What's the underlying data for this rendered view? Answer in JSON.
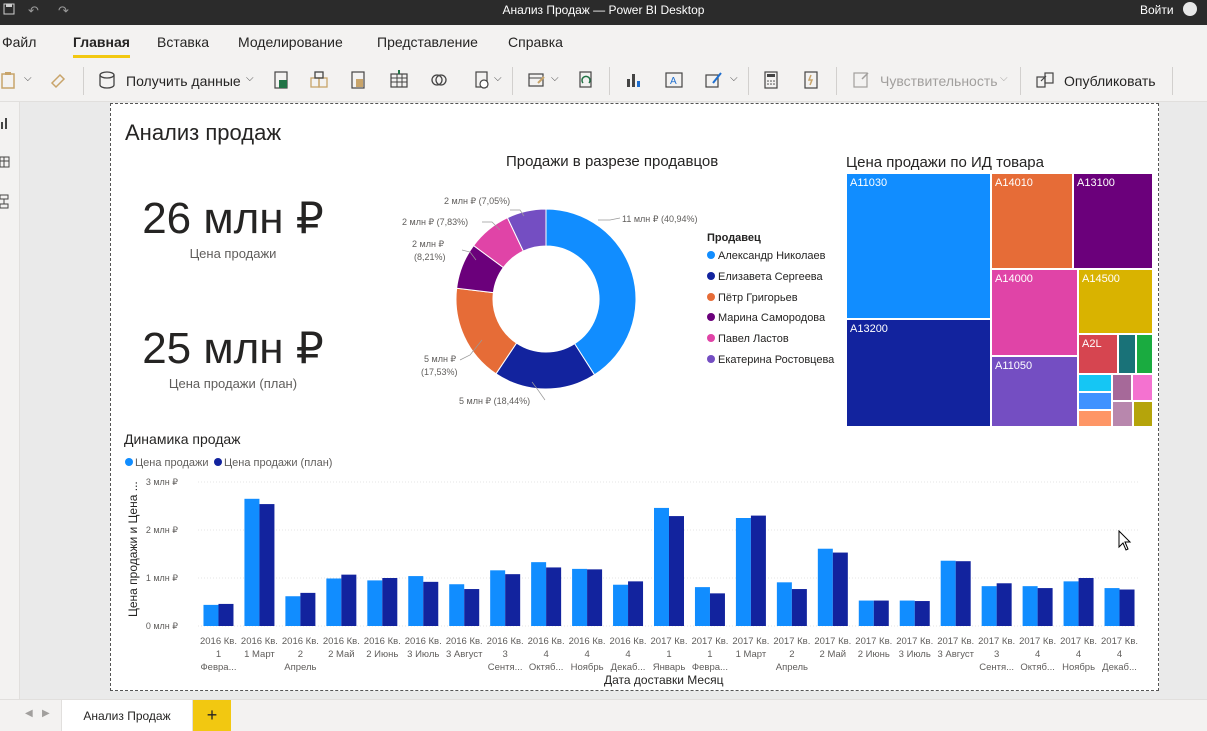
{
  "window": {
    "title": "Анализ Продаж — Power BI Desktop",
    "signin": "Войти"
  },
  "menu": {
    "tabs": [
      "Файл",
      "Главная",
      "Вставка",
      "Моделирование",
      "Представление",
      "Справка"
    ],
    "active": "Главная"
  },
  "ribbon": {
    "get_data": "Получить данные",
    "sensitivity": "Чувствительность",
    "publish": "Опубликовать"
  },
  "report": {
    "title": "Анализ продаж",
    "kpi1": {
      "value": "26 млн ₽",
      "label": "Цена продажи"
    },
    "kpi2": {
      "value": "25 млн ₽",
      "label": "Цена продажи (план)"
    }
  },
  "donut": {
    "title": "Продажи в разрезе продавцов",
    "legend_title": "Продавец",
    "slices": [
      {
        "name": "Александр Николаев",
        "label": "11 млн ₽ (40,94%)",
        "pct": 40.94,
        "color": "#118dff"
      },
      {
        "name": "Елизавета Сергеева",
        "label": "5 млн ₽ (18,44%)",
        "pct": 18.44,
        "color": "#12239e"
      },
      {
        "name": "Пётр Григорьев",
        "label": "5 млн ₽ (17,53%)",
        "pct": 17.53,
        "color": "#e66c37"
      },
      {
        "name": "Марина Самородова",
        "label": "2 млн ₽ (8,21%)",
        "pct": 8.21,
        "color": "#6b007b"
      },
      {
        "name": "Павел Ластов",
        "label": "2 млн ₽ (7,83%)",
        "pct": 7.83,
        "color": "#e044a7"
      },
      {
        "name": "Екатерина Ростовцева",
        "label": "2 млн ₽ (7,05%)",
        "pct": 7.05,
        "color": "#744ec2"
      }
    ],
    "outside_labels": {
      "s0": "11 млн ₽ (40,94%)",
      "s1": "5 млн ₽ (18,44%)",
      "s2a": "5 млн ₽",
      "s2b": "(17,53%)",
      "s3a": "2 млн ₽",
      "s3b": "(8,21%)",
      "s4": "2 млн ₽ (7,83%)",
      "s5": "2 млн ₽ (7,05%)"
    }
  },
  "treemap": {
    "title": "Цена продажи по ИД товара",
    "cells": [
      {
        "id": "A11030",
        "color": "#118dff"
      },
      {
        "id": "A13200",
        "color": "#12239e"
      },
      {
        "id": "A14010",
        "color": "#e66c37"
      },
      {
        "id": "A13100",
        "color": "#6b007b"
      },
      {
        "id": "A14000",
        "color": "#e044a7"
      },
      {
        "id": "A14500",
        "color": "#d9b300"
      },
      {
        "id": "A11050",
        "color": "#744ec2"
      },
      {
        "id": "A2L",
        "color": "#d64550"
      }
    ]
  },
  "columns": {
    "title": "Динамика продаж",
    "legend": [
      "Цена продажи",
      "Цена продажи (план)"
    ],
    "colors": [
      "#118dff",
      "#12239e"
    ],
    "xlabel": "Дата доставки Месяц",
    "ylabel": "Цена продажи и Цена ...",
    "y_ticks": [
      "0 млн ₽",
      "1 млн ₽",
      "2 млн ₽",
      "3 млн ₽"
    ]
  },
  "chart_data": {
    "type": "bar",
    "title": "Динамика продаж",
    "xlabel": "Дата доставки Месяц",
    "ylabel": "Цена продажи и Цена ...",
    "ylim": [
      0,
      3
    ],
    "categories": [
      [
        "2016 Кв.",
        "1",
        "Февра..."
      ],
      [
        "2016 Кв.",
        "1 Март",
        ""
      ],
      [
        "2016 Кв.",
        "2",
        "Апрель"
      ],
      [
        "2016 Кв.",
        "2 Май",
        ""
      ],
      [
        "2016 Кв.",
        "2 Июнь",
        ""
      ],
      [
        "2016 Кв.",
        "3 Июль",
        ""
      ],
      [
        "2016 Кв.",
        "3 Август",
        ""
      ],
      [
        "2016 Кв.",
        "3",
        "Сентя..."
      ],
      [
        "2016 Кв.",
        "4",
        "Октяб..."
      ],
      [
        "2016 Кв.",
        "4",
        "Ноябрь"
      ],
      [
        "2016 Кв.",
        "4",
        "Декаб..."
      ],
      [
        "2017 Кв.",
        "1",
        "Январь"
      ],
      [
        "2017 Кв.",
        "1",
        "Февра..."
      ],
      [
        "2017 Кв.",
        "1 Март",
        ""
      ],
      [
        "2017 Кв.",
        "2",
        "Апрель"
      ],
      [
        "2017 Кв.",
        "2 Май",
        ""
      ],
      [
        "2017 Кв.",
        "2 Июнь",
        ""
      ],
      [
        "2017 Кв.",
        "3 Июль",
        ""
      ],
      [
        "2017 Кв.",
        "3 Август",
        ""
      ],
      [
        "2017 Кв.",
        "3",
        "Сентя..."
      ],
      [
        "2017 Кв.",
        "4",
        "Октяб..."
      ],
      [
        "2017 Кв.",
        "4",
        "Ноябрь"
      ],
      [
        "2017 Кв.",
        "4",
        "Декаб..."
      ]
    ],
    "series": [
      {
        "name": "Цена продажи",
        "values": [
          0.44,
          2.65,
          0.62,
          0.99,
          0.95,
          1.04,
          0.87,
          1.16,
          1.33,
          1.19,
          0.86,
          2.46,
          0.81,
          2.25,
          0.91,
          1.61,
          0.53,
          0.53,
          1.36,
          0.83,
          0.83,
          0.93,
          0.79
        ]
      },
      {
        "name": "Цена продажи (план)",
        "values": [
          0.46,
          2.54,
          0.69,
          1.07,
          1.0,
          0.92,
          0.77,
          1.08,
          1.22,
          1.18,
          0.93,
          2.29,
          0.68,
          2.3,
          0.77,
          1.53,
          0.53,
          0.52,
          1.35,
          0.89,
          0.79,
          1.0,
          0.76
        ]
      }
    ]
  },
  "pages": {
    "tabs": [
      "Анализ Продаж"
    ],
    "add": "+"
  }
}
